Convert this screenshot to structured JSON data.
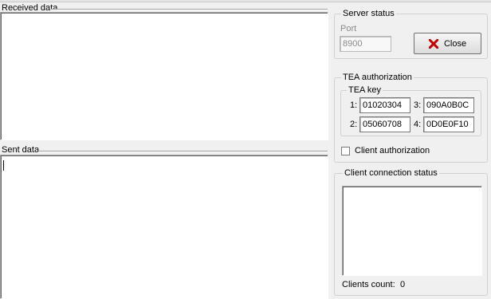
{
  "received": {
    "title": "Received data",
    "content": ""
  },
  "sent": {
    "title": "Sent data",
    "content": ""
  },
  "server_status": {
    "title": "Server status",
    "port_label": "Port",
    "port_value": "8900",
    "close_label": "Close"
  },
  "tea": {
    "title": "TEA authorization",
    "key_title": "TEA key",
    "keys": [
      {
        "index": "1:",
        "value": "01020304"
      },
      {
        "index": "2:",
        "value": "05060708"
      },
      {
        "index": "3:",
        "value": "090A0B0C"
      },
      {
        "index": "4:",
        "value": "0D0E0F10"
      }
    ],
    "client_auth_label": "Client authorization",
    "client_auth_checked": false
  },
  "client_status": {
    "title": "Client connection status",
    "clients_count_label": "Clients count:",
    "clients_count_value": "0"
  },
  "colors": {
    "close_icon": "#c00000"
  }
}
